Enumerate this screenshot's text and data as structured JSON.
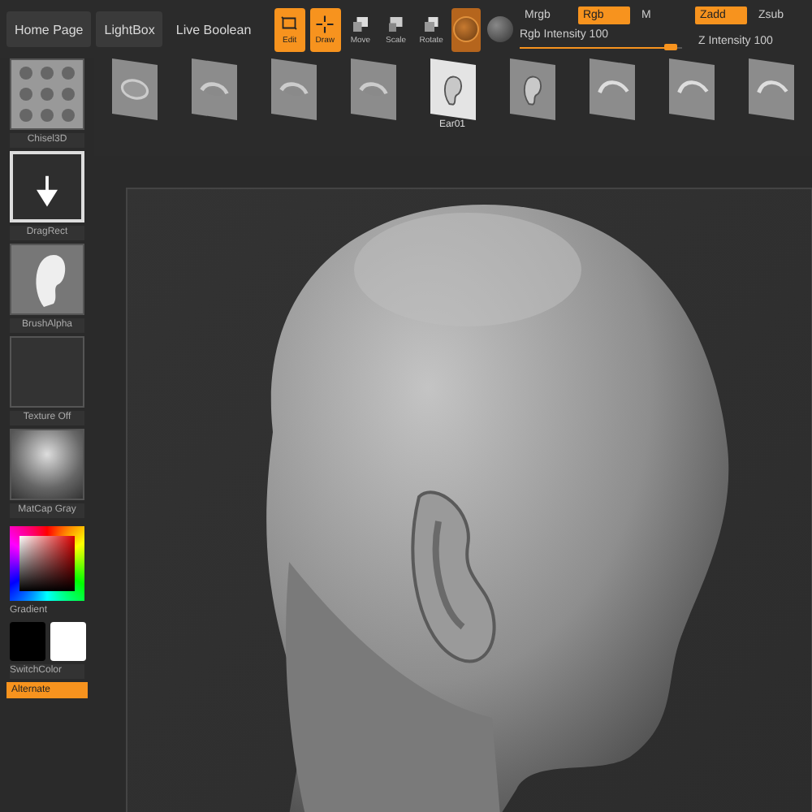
{
  "top_bar": {
    "tabs": [
      {
        "label": "Home Page",
        "kind": "tab"
      },
      {
        "label": "LightBox",
        "kind": "tab"
      },
      {
        "label": "Live Boolean",
        "kind": "plain"
      }
    ],
    "modes": [
      {
        "label": "Edit",
        "selected": true
      },
      {
        "label": "Draw",
        "selected": true
      },
      {
        "label": "Move",
        "selected": false
      },
      {
        "label": "Scale",
        "selected": false
      },
      {
        "label": "Rotate",
        "selected": false
      }
    ],
    "material_toggles": [
      {
        "selected": true
      },
      {
        "selected": false
      }
    ],
    "channels": [
      {
        "label": "Mrgb",
        "selected": false
      },
      {
        "label": "Rgb",
        "selected": true
      },
      {
        "label": "M",
        "selected": false
      }
    ],
    "depth": [
      {
        "label": "Zadd",
        "selected": true
      },
      {
        "label": "Zsub",
        "selected": false
      }
    ],
    "rgb_intensity": {
      "label": "Rgb Intensity",
      "value": "100",
      "level": 0.97
    },
    "z_intensity": {
      "label": "Z Intensity",
      "value": "100"
    }
  },
  "brushes": [
    {
      "selected": false
    },
    {
      "selected": false
    },
    {
      "selected": false
    },
    {
      "selected": false
    },
    {
      "label": "Ear01",
      "selected": true
    },
    {
      "selected": false
    },
    {
      "selected": false
    },
    {
      "selected": false
    },
    {
      "selected": false
    }
  ],
  "left_panel": {
    "brush": {
      "label": "Chisel3D"
    },
    "tiles": [
      {
        "kind": "stroke",
        "label": "DragRect"
      },
      {
        "kind": "alpha",
        "label": "BrushAlpha"
      },
      {
        "kind": "texture",
        "label": "Texture Off"
      },
      {
        "kind": "material",
        "label": "MatCap Gray"
      }
    ],
    "gradient_label": "Gradient",
    "swatches": [
      {
        "color": "#000000"
      },
      {
        "color": "#ffffff"
      }
    ],
    "switch_color": "SwitchColor",
    "alternate": {
      "label": "Alternate",
      "selected": true
    }
  }
}
